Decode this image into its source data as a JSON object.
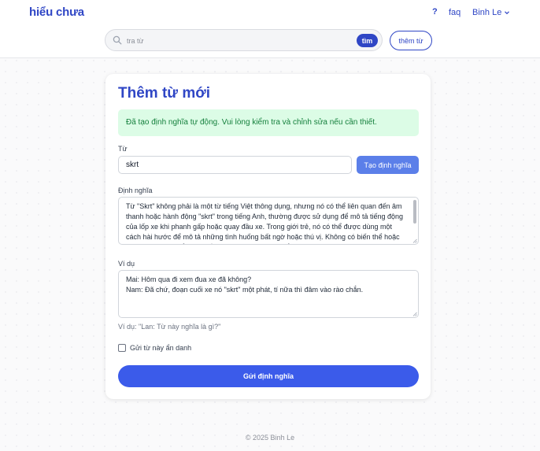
{
  "header": {
    "logo": "hiểu chưa",
    "help_label": "?",
    "faq_label": "faq",
    "user_name": "Binh Le",
    "search": {
      "placeholder": "tra từ",
      "button_label": "tìm"
    },
    "add_word_label": "thêm từ"
  },
  "form": {
    "title": "Thêm từ mới",
    "alert": "Đã tạo định nghĩa tự động. Vui lòng kiểm tra và chỉnh sửa nếu cần thiết.",
    "word_label": "Từ",
    "word_value": "skrt",
    "generate_label": "Tạo định nghĩa",
    "definition_label": "Định nghĩa",
    "definition_value": "Từ \"Skrt\" không phải là một từ tiếng Việt thông dụng, nhưng nó có thể liên quan đến âm thanh hoặc hành động \"skrt\" trong tiếng Anh, thường được sử dụng để mô tả tiếng động của lốp xe khi phanh gấp hoặc quay đầu xe. Trong giới trẻ, nó có thể được dùng một cách hài hước để mô tả những tình huống bất ngờ hoặc thú vị. Không có biến thể hoặc từ liên quan cụ thể trong tiếng Việt, nhưng nó có thể được sử dụng như một cách chơi chữ.",
    "example_label": "Ví dụ",
    "example_line1": "Mai: Hôm qua đi xem đua xe đã không?",
    "example_line2": "Nam: Đã chứ, đoạn cuối xe nó \"skrt\" một phát, tí nữa thì đâm vào rào chắn.",
    "example_hint": "Ví dụ: \"Lan: Từ này nghĩa là gì?\"",
    "anonymous_label": "Gửi từ này ẩn danh",
    "submit_label": "Gửi định nghĩa"
  },
  "footer": {
    "copyright": "© 2025 Binh Le"
  },
  "colors": {
    "accent": "#2f46c5",
    "submit": "#3b5bea",
    "alert_bg": "#dcfce6",
    "alert_text": "#15803d"
  }
}
